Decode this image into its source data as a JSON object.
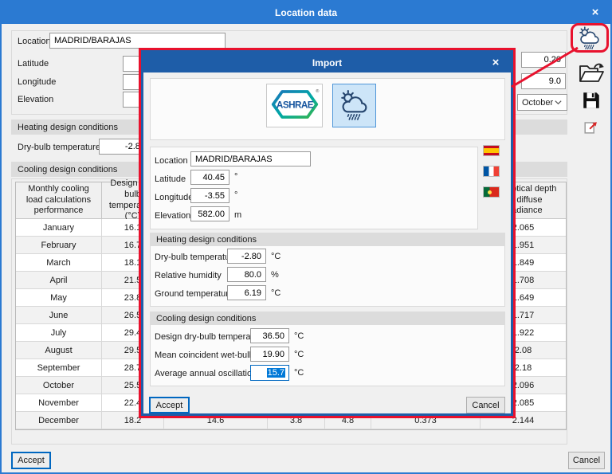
{
  "colors": {
    "titlebar_main": "#2b7ad2",
    "titlebar_import": "#1e5da8",
    "annotation_red": "#e8112d",
    "focus_blue": "#0067c0",
    "selection_blue": "#0078d7",
    "selected_source_bg": "#cde5f8"
  },
  "window": {
    "title": "Location data",
    "close_glyph": "×"
  },
  "form": {
    "location_label": "Location",
    "location_value": "MADRID/BARAJAS",
    "latitude_label": "Latitude",
    "longitude_label": "Longitude",
    "elevation_label": "Elevation",
    "field1_value": "0.20",
    "field2_value": "9.0",
    "month_value": "October"
  },
  "heating": {
    "header": "Heating design conditions",
    "dry_bulb_label": "Dry-bulb temperature",
    "dry_bulb_value": "-2.80"
  },
  "cooling": {
    "header": "Cooling design conditions"
  },
  "table": {
    "headers": [
      "Monthly cooling load calculations performance",
      "Design dry-bulb temperature (°C)",
      "",
      "",
      "",
      "",
      "Sky optical depth for diffuse irradiance"
    ],
    "rows": [
      [
        "January",
        "16.1",
        "",
        "",
        "",
        "",
        "2.065"
      ],
      [
        "February",
        "16.7",
        "",
        "",
        "",
        "",
        "1.951"
      ],
      [
        "March",
        "18.1",
        "",
        "",
        "",
        "",
        "1.849"
      ],
      [
        "April",
        "21.5",
        "",
        "",
        "",
        "",
        "1.708"
      ],
      [
        "May",
        "23.8",
        "",
        "",
        "",
        "",
        "1.649"
      ],
      [
        "June",
        "26.5",
        "",
        "",
        "",
        "",
        "1.717"
      ],
      [
        "July",
        "29.4",
        "",
        "",
        "",
        "",
        "1.922"
      ],
      [
        "August",
        "29.5",
        "",
        "",
        "",
        "",
        "2.08"
      ],
      [
        "September",
        "28.7",
        "",
        "",
        "",
        "",
        "2.18"
      ],
      [
        "October",
        "25.5",
        "",
        "",
        "",
        "",
        "2.096"
      ],
      [
        "November",
        "22.4",
        "",
        "",
        "",
        "",
        "2.085"
      ],
      [
        "December",
        "18.2",
        "14.6",
        "3.8",
        "4.8",
        "0.373",
        "2.144"
      ]
    ]
  },
  "buttons": {
    "accept": "Accept",
    "cancel": "Cancel"
  },
  "toolbar": {
    "icons": [
      "weather-import",
      "open-file",
      "save",
      "export"
    ]
  },
  "import": {
    "title": "Import",
    "close_glyph": "×",
    "sources": {
      "ashrae_label": "ASHRAE",
      "weather_icon": "weather-icon"
    },
    "fields": {
      "location_label": "Location",
      "location_value": "MADRID/BARAJAS",
      "latitude_label": "Latitude",
      "latitude_value": "40.45",
      "latitude_unit": "°",
      "longitude_label": "Longitude",
      "longitude_value": "-3.55",
      "longitude_unit": "°",
      "elevation_label": "Elevation",
      "elevation_value": "582.00",
      "elevation_unit": "m"
    },
    "flags": [
      "flag-spain",
      "flag-france",
      "flag-portugal"
    ],
    "heating": {
      "header": "Heating design conditions",
      "rows": [
        {
          "label": "Dry-bulb temperature",
          "value": "-2.80",
          "unit": "°C"
        },
        {
          "label": "Relative humidity",
          "value": "80.0",
          "unit": "%"
        },
        {
          "label": "Ground temperature",
          "value": "6.19",
          "unit": "°C"
        }
      ]
    },
    "cooling": {
      "header": "Cooling design conditions",
      "rows": [
        {
          "label": "Design dry-bulb temperature",
          "value": "36.50",
          "unit": "°C"
        },
        {
          "label": "Mean coincident wet-bulb",
          "value": "19.90",
          "unit": "°C"
        },
        {
          "label": "Average annual oscillation",
          "value": "15.7",
          "unit": "°C"
        }
      ]
    },
    "accept_label": "Accept",
    "cancel_label": "Cancel"
  }
}
